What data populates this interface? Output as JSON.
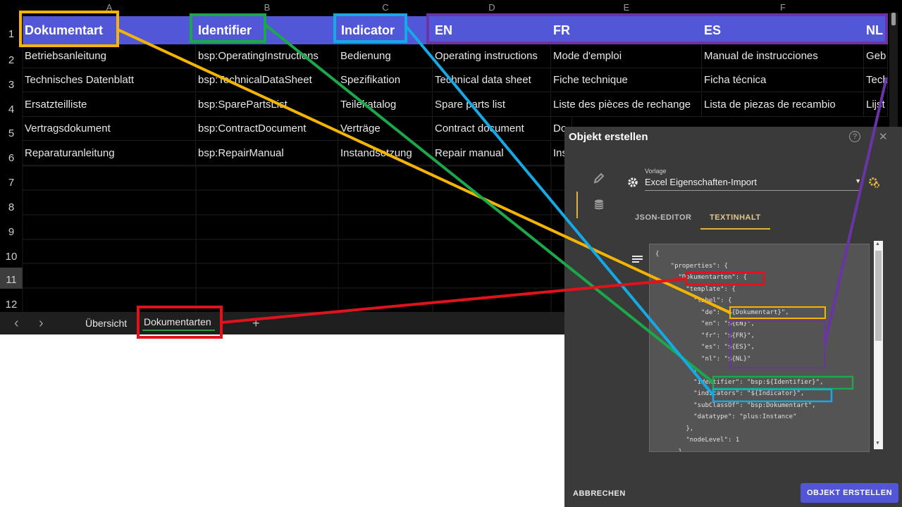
{
  "sheet": {
    "columns": [
      "A",
      "B",
      "C",
      "D",
      "E",
      "F"
    ],
    "header": [
      "Dokumentart",
      "Identifier",
      "Indicator",
      "EN",
      "FR",
      "ES",
      "NL"
    ],
    "rows": [
      [
        "Betriebsanleitung",
        "bsp:OperatingInstructions",
        "Bedienung",
        "Operating instructions",
        "Mode d'emploi",
        "Manual de instrucciones",
        "Geb"
      ],
      [
        "Technisches Datenblatt",
        "bsp:TechnicalDataSheet",
        "Spezifikation",
        "Technical data sheet",
        "Fiche technique",
        "Ficha técnica",
        "Tech"
      ],
      [
        "Ersatzteilliste",
        "bsp:SparePartsList",
        "Teilekatalog",
        "Spare parts list",
        "Liste des pièces de rechange",
        "Lista de piezas de recambio",
        "Lijst"
      ],
      [
        "Vertragsdokument",
        "bsp:ContractDocument",
        "Verträge",
        "Contract document",
        "Do",
        "",
        "",
        ""
      ],
      [
        "Reparaturanleitung",
        "bsp:RepairManual",
        "Instandsetzung",
        "Repair manual",
        "Ins",
        "",
        ""
      ]
    ],
    "row_numbers": [
      "1",
      "2",
      "3",
      "4",
      "5",
      "6",
      "7",
      "8",
      "9",
      "10",
      "11",
      "12"
    ],
    "tabs": {
      "nav_prev": "‹",
      "nav_next": "›",
      "overview": "Übersicht",
      "active": "Dokumentarten",
      "add": "+"
    }
  },
  "dialog": {
    "title": "Objekt erstellen",
    "help": "?",
    "close": "✕",
    "template_label": "Vorlage",
    "template_value": "Excel Eigenschaften-Import",
    "tab_json": "JSON-EDITOR",
    "tab_text": "TEXTINHALT",
    "code": "{\n    \"properties\": {\n      \"Dokumentarten\": {\n        \"template\": {\n          \"label\": {\n            \"de\": \"${Dokumentart}\",\n            \"en\": \"${EN}\",\n            \"fr\": \"${FR}\",\n            \"es\": \"${ES}\",\n            \"nl\": \"${NL}\"\n          },\n          \"identifier\": \"bsp:${Identifier}\",\n          \"indicators\": \"${Indicator}\",\n          \"subClassOf\": \"bsp:Dokumentart\",\n          \"datatype\": \"plus:Instance\"\n        },\n        \"nodeLevel\": 1\n      }",
    "cancel": "ABBRECHEN",
    "create": "OBJEKT ERSTELLEN"
  },
  "colors": {
    "header_bg": "#5257d8",
    "accent_button": "#5256d6",
    "tab_underline": "#2e9b3e",
    "yellow": "#f5b400",
    "green": "#1aa84a",
    "cyan": "#15a9e6",
    "purple": "#6a33a8",
    "red": "#e0131c"
  }
}
